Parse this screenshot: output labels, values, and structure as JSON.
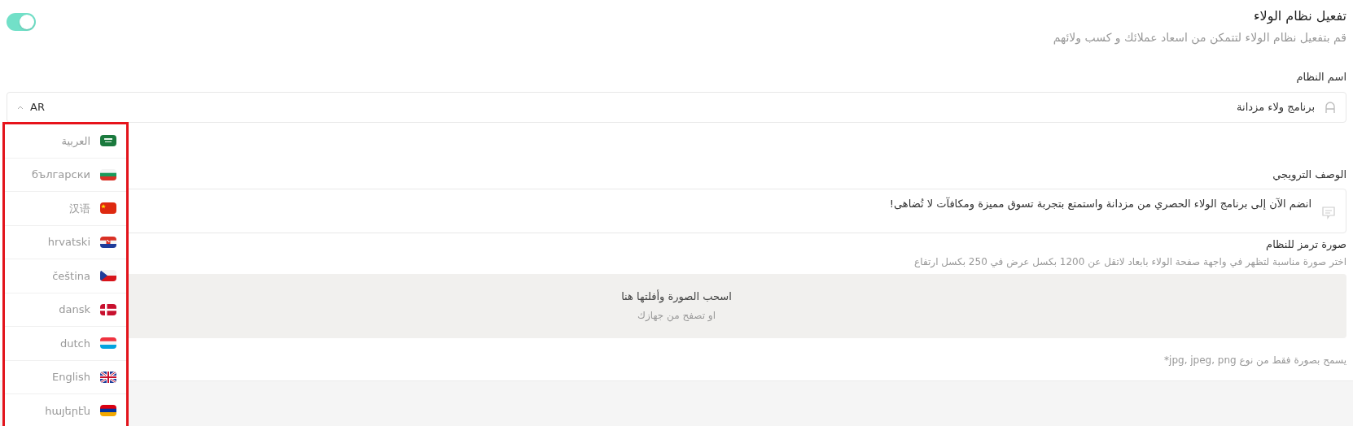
{
  "loyalty_toggle": {
    "on": true
  },
  "header": {
    "title": "تفعيل نظام الولاء",
    "subtitle": "قم بتفعيل نظام الولاء لتتمكن من اسعاد عملائك و كسب ولائهم"
  },
  "name_field": {
    "label": "اسم النظام",
    "value": "برنامج ولاء مزدانة",
    "language": "AR",
    "expanded": true
  },
  "language_menu": {
    "items": [
      {
        "label": "العربية",
        "kind": "sa"
      },
      {
        "label": "български",
        "kind": "bg"
      },
      {
        "label": "汉语",
        "kind": "cn"
      },
      {
        "label": "hrvatski",
        "kind": "hr"
      },
      {
        "label": "čeština",
        "kind": "cz"
      },
      {
        "label": "dansk",
        "kind": "dk"
      },
      {
        "label": "dutch",
        "kind": "lu"
      },
      {
        "label": "English",
        "kind": "gb"
      },
      {
        "label": "հայերէն",
        "kind": "am"
      }
    ]
  },
  "description_field": {
    "label": "الوصف الترويجي",
    "value": "انضم الآن إلى برنامج الولاء الحصري من مزدانة واستمتع بتجربة تسوق مميزة ومكافآت لا تُضاهى!"
  },
  "image_upload": {
    "label": "صورة ترمز للنظام",
    "hint": "اختر صورة مناسبة لتظهر في واجهة صفحة الولاء بابعاد لاتقل عن 1200 بكسل عرض في 250 بكسل ارتفاع",
    "drop_title": "اسحب الصورة وأفلتها هنا",
    "drop_subtitle": "او تصفح من جهازك",
    "note": "يسمح بصورة فقط من نوع jpg, jpeg, png*"
  }
}
